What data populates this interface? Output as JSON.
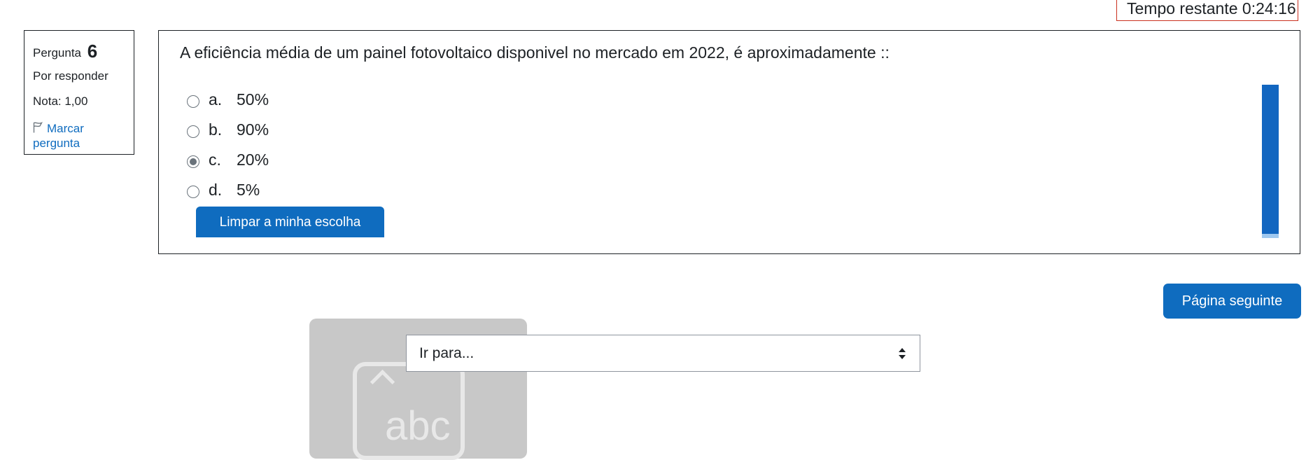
{
  "timer": {
    "label": "Tempo restante 0:24:16"
  },
  "question_info": {
    "label": "Pergunta",
    "number": "6",
    "state": "Por responder",
    "grade": "Nota: 1,00",
    "flag_label": "Marcar pergunta"
  },
  "question": {
    "text": "A eficiência média de um painel fotovoltaico disponivel no mercado em 2022, é aproximadamente ::",
    "answers": [
      {
        "letter": "a.",
        "text": "50%",
        "checked": false
      },
      {
        "letter": "b.",
        "text": "90%",
        "checked": false
      },
      {
        "letter": "c.",
        "text": "20%",
        "checked": true
      },
      {
        "letter": "d.",
        "text": "5%",
        "checked": false
      }
    ],
    "clear_label": "Limpar a minha escolha"
  },
  "navigation": {
    "next_label": "Página seguinte",
    "jump_placeholder": "Ir para..."
  },
  "overlay": {
    "keyboard_icon_text": "abc"
  },
  "colors": {
    "accent": "#0f6cbf",
    "timer_border": "#ca3120"
  },
  "icons": [
    "flag-icon",
    "select-arrows-icon",
    "keyboard-icon"
  ]
}
